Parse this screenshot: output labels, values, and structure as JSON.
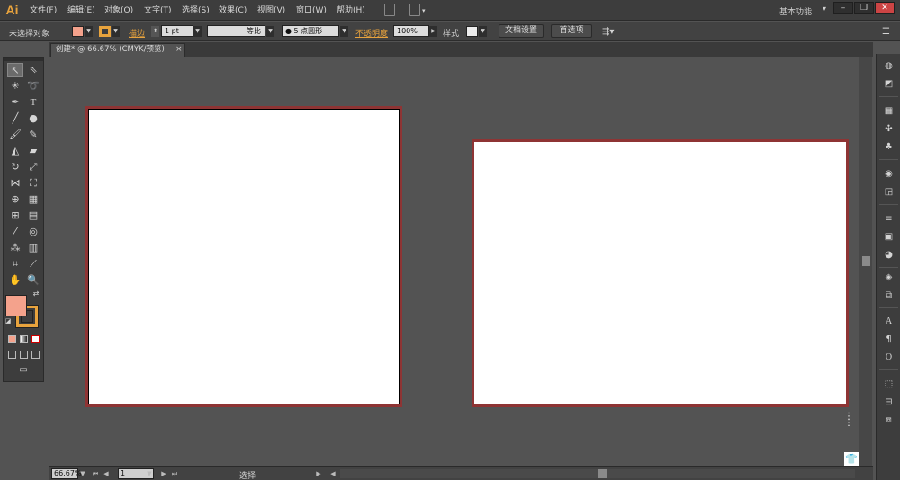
{
  "app": {
    "logo": "Ai",
    "menus": [
      "文件(F)",
      "编辑(E)",
      "对象(O)",
      "文字(T)",
      "选择(S)",
      "效果(C)",
      "视图(V)",
      "窗口(W)",
      "帮助(H)"
    ],
    "workspace": "基本功能",
    "window_buttons": [
      "–",
      "❐",
      "✕"
    ]
  },
  "control_bar": {
    "selection_label": "未选择对象",
    "stroke_label": "描边",
    "stroke_weight": "1 pt",
    "line_style_label": "等比",
    "brush": "● 5 点圆形",
    "opacity_label": "不透明度",
    "opacity_value": "100%",
    "style_label": "样式",
    "doc_settings_button": "文档设置",
    "preferences_button": "首选项",
    "fill_color": "#f4a28c",
    "stroke_color": "#e8a33d"
  },
  "document": {
    "tab_title": "创建* @ 66.67% (CMYK/预览)",
    "tab_close": "×"
  },
  "tools": {
    "fill_color": "#f4a28c",
    "stroke_color": "#e8a33d"
  },
  "status_bar": {
    "zoom": "66.67%",
    "page": "1",
    "status_text": "选择"
  },
  "artboards": [
    {
      "name": "artboard-1"
    },
    {
      "name": "artboard-2"
    }
  ]
}
